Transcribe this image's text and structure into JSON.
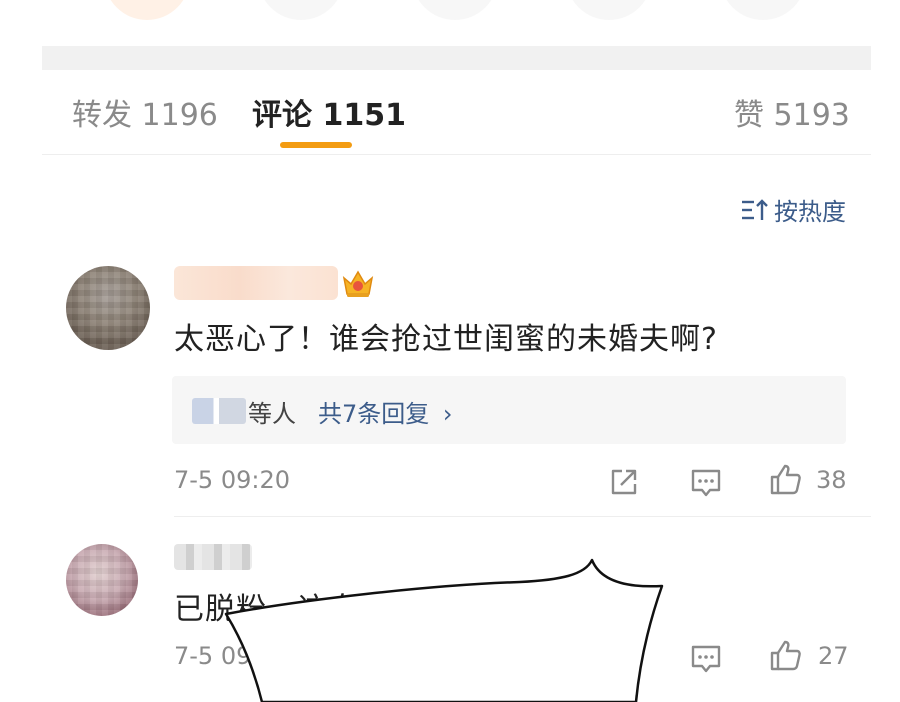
{
  "tabs": {
    "repost_label": "转发",
    "repost_count": "1196",
    "comment_label": "评论",
    "comment_count": "1151",
    "like_label": "赞",
    "like_count": "5193"
  },
  "sort": {
    "label": "按热度"
  },
  "comments": [
    {
      "text": "太恶心了！谁会抢过世闺蜜的未婚夫啊?",
      "reply_suffix": "等人",
      "reply_link": "共7条回复",
      "time": "7-5 09:20",
      "likes": "38"
    },
    {
      "text": "已脱粉，这女人真是恶",
      "time": "7-5 09:2",
      "likes": "27"
    }
  ],
  "colors": {
    "accent": "#f39c12",
    "link": "#3c5c8a",
    "muted": "#8a8a8a"
  }
}
